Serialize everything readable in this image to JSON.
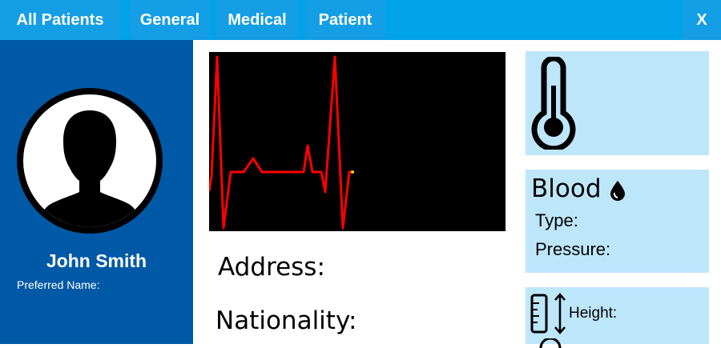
{
  "tabs": [
    {
      "label": "All Patients"
    },
    {
      "label": "General"
    },
    {
      "label": "Medical"
    },
    {
      "label": "Patient"
    }
  ],
  "close_label": "X",
  "patient": {
    "name": "John Smith",
    "preferred_name_label": "Preferred Name:"
  },
  "fields": {
    "address_label": "Address:",
    "nationality_label": "Nationality:"
  },
  "blood": {
    "title": "Blood",
    "type_label": "Type:",
    "pressure_label": "Pressure:"
  },
  "height": {
    "label": "Height:"
  },
  "icons": {
    "temperature": "thermometer-icon",
    "blood": "blood-drop-icon",
    "ruler": "ruler-icon",
    "arrow": "vertical-arrow-icon",
    "avatar": "user-silhouette-icon"
  },
  "colors": {
    "topbar": "#00a2e8",
    "tab": "#149ee5",
    "sidebar": "#0059a6",
    "panel": "#bde6fb",
    "ecg_line": "#ff0000",
    "ecg_background": "#000000"
  }
}
